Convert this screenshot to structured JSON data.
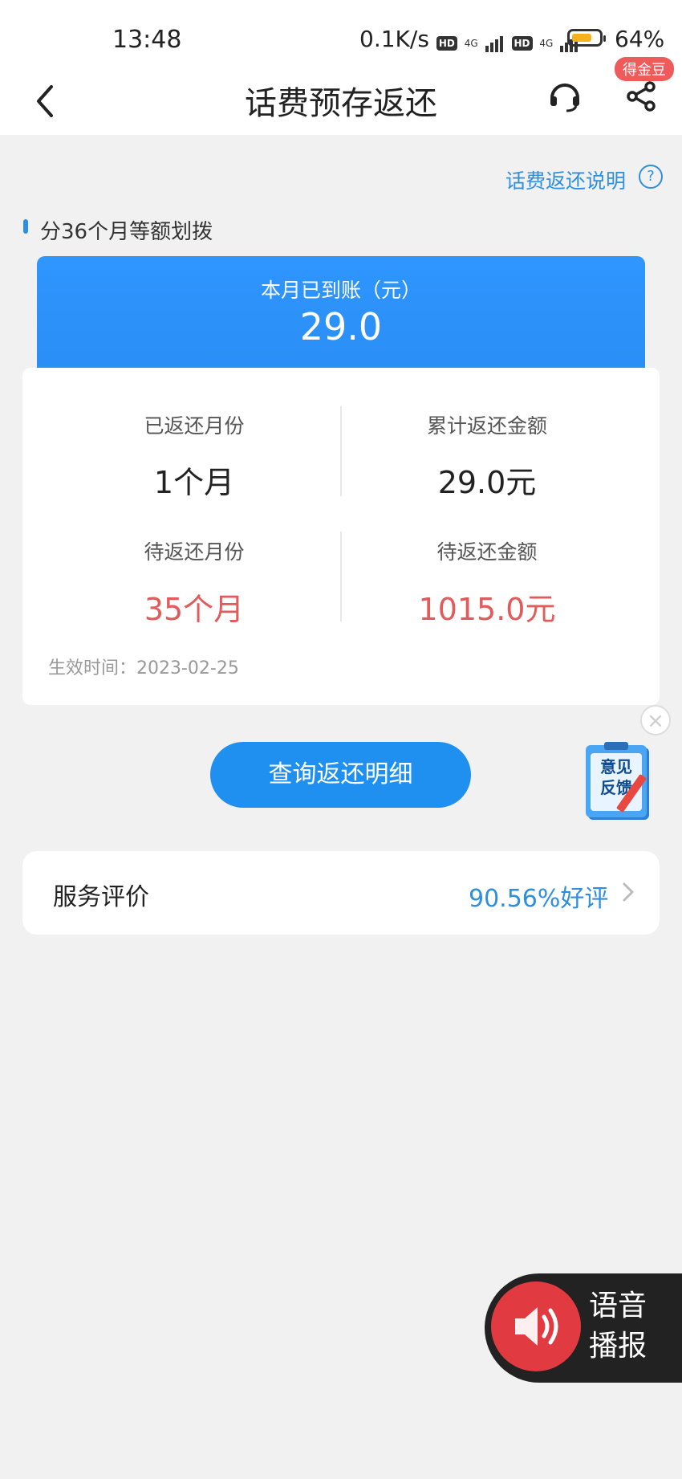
{
  "status_bar": {
    "time": "13:48",
    "network_speed": "0.1K/s",
    "hd_badge": "HD",
    "network_type": "4G",
    "battery_percent": "64%"
  },
  "header": {
    "title": "话费预存返还",
    "badge": "得金豆"
  },
  "explain_link": "话费返还说明",
  "help_symbol": "?",
  "section_label": "分36个月等额划拨",
  "current_month": {
    "label": "本月已到账（元）",
    "value": "29.0"
  },
  "stats": {
    "returned_months": {
      "label": "已返还月份",
      "value": "1个月"
    },
    "total_returned": {
      "label": "累计返还金额",
      "value": "29.0元"
    },
    "pending_months": {
      "label": "待返还月份",
      "value": "35个月"
    },
    "pending_amount": {
      "label": "待返还金额",
      "value": "1015.0元"
    },
    "effective_date": "生效时间：2023-02-25"
  },
  "query_button": "查询返还明细",
  "feedback": {
    "line1": "意见",
    "line2": "反馈",
    "close": "×"
  },
  "service_rating": {
    "label": "服务评价",
    "value": "90.56%好评"
  },
  "voice_broadcast": {
    "line1": "语音",
    "line2": "播报"
  },
  "colors": {
    "accent": "#2e8fe0",
    "red": "#e15b5b",
    "card_blue": "#2f96ff"
  }
}
